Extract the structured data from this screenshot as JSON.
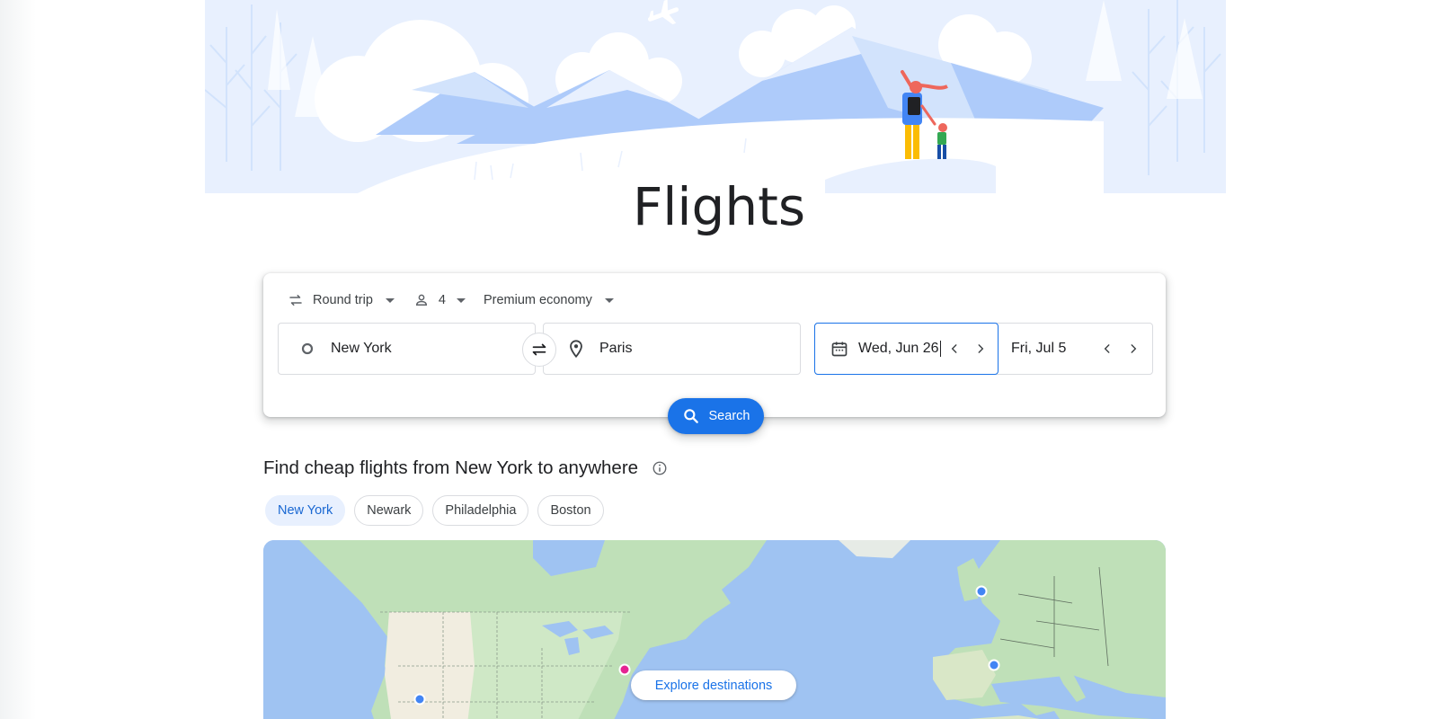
{
  "page_title": "Flights",
  "trip_options": {
    "trip_type": "Round trip",
    "passengers": "4",
    "cabin_class": "Premium economy"
  },
  "search": {
    "origin": "New York",
    "destination": "Paris",
    "depart_date": "Wed, Jun 26",
    "return_date": "Fri, Jul 5",
    "button_label": "Search"
  },
  "cheap_flights": {
    "heading": "Find cheap flights from New York to anywhere",
    "chips": [
      "New York",
      "Newark",
      "Philadelphia",
      "Boston"
    ],
    "active_chip": "New York"
  },
  "map": {
    "explore_label": "Explore destinations"
  },
  "colors": {
    "accent": "#1a73e8",
    "chip_active_bg": "#e8f0fe",
    "origin_marker": "#e52592",
    "destination_marker": "#4285f4",
    "ocean": "#9fc3f2",
    "land": "#bfe0b8"
  }
}
